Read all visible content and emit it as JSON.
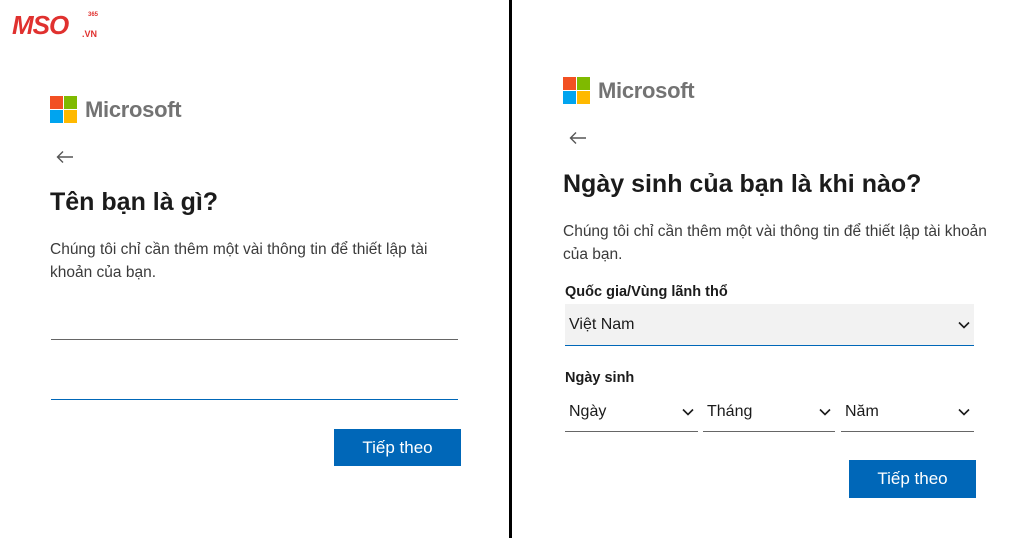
{
  "watermark": {
    "brand": "MSO",
    "suffix": ".VN",
    "superscript": "365"
  },
  "colors": {
    "ms_red": "#f25022",
    "ms_green": "#7fba00",
    "ms_blue": "#00a4ef",
    "ms_yellow": "#ffb900",
    "primary": "#0067b8",
    "watermark": "#e0312f"
  },
  "left_panel": {
    "brand_name": "Microsoft",
    "back_icon": "arrow-left-icon",
    "title": "Tên bạn là gì?",
    "description": "Chúng tôi chỉ cần thêm một vài thông tin để thiết lập tài khoản của bạn.",
    "first_input": {
      "value": "",
      "placeholder": ""
    },
    "second_input": {
      "value": "",
      "placeholder": ""
    },
    "next_button": "Tiếp theo"
  },
  "right_panel": {
    "brand_name": "Microsoft",
    "back_icon": "arrow-left-icon",
    "title": "Ngày sinh của bạn là khi nào?",
    "description": "Chúng tôi chỉ cần thêm một vài thông tin để thiết lập tài khoản của bạn.",
    "country_label": "Quốc gia/Vùng lãnh thổ",
    "country_value": "Việt Nam",
    "birthdate_label": "Ngày sinh",
    "day_select": "Ngày",
    "month_select": "Tháng",
    "year_select": "Năm",
    "next_button": "Tiếp theo"
  }
}
